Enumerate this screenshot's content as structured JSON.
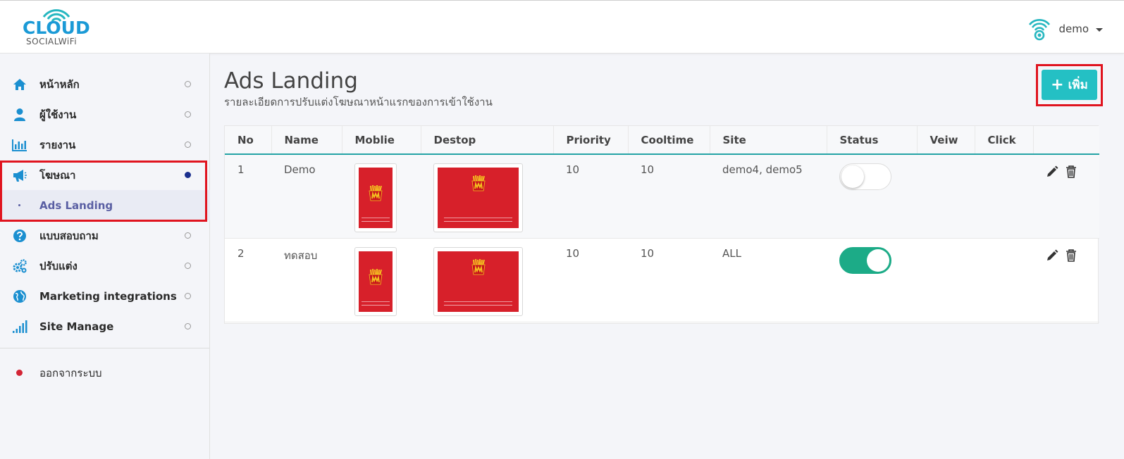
{
  "header": {
    "logo_main": "CLOUD",
    "logo_sub": "SOCIALWiFi",
    "username": "demo"
  },
  "sidebar": {
    "items": [
      {
        "label": "หน้าหลัก",
        "icon": "home-icon",
        "active": false
      },
      {
        "label": "ผู้ใช้งาน",
        "icon": "user-icon",
        "active": false
      },
      {
        "label": "รายงาน",
        "icon": "bar-chart-icon",
        "active": false
      },
      {
        "label": "โฆษณา",
        "icon": "megaphone-icon",
        "active": true
      },
      {
        "label": "Ads Landing",
        "icon": "",
        "active": false,
        "sub": true
      },
      {
        "label": "แบบสอบถาม",
        "icon": "question-icon",
        "active": false
      },
      {
        "label": "ปรับแต่ง",
        "icon": "cogs-icon",
        "active": false
      },
      {
        "label": "Marketing integrations",
        "icon": "globe-icon",
        "active": false
      },
      {
        "label": "Site Manage",
        "icon": "signal-icon",
        "active": false
      }
    ],
    "logout_label": "ออกจากระบบ"
  },
  "main": {
    "title": "Ads Landing",
    "subtitle": "รายละเอียดการปรับแต่งโฆษณาหน้าแรกของการเข้าใช้งาน",
    "add_button": "เพิ่ม",
    "columns": [
      "No",
      "Name",
      "Moblie",
      "Destop",
      "Priority",
      "Cooltime",
      "Site",
      "Status",
      "Veiw",
      "Click",
      ""
    ],
    "rows": [
      {
        "no": "1",
        "name": "Demo",
        "priority": "10",
        "cooltime": "10",
        "site": "demo4, demo5",
        "status_on": false,
        "view": "",
        "click": ""
      },
      {
        "no": "2",
        "name": "ทดสอบ",
        "priority": "10",
        "cooltime": "10",
        "site": "ALL",
        "status_on": true,
        "view": "",
        "click": ""
      }
    ]
  },
  "colors": {
    "accent": "#24c0c4",
    "toggle_on": "#1cab87",
    "highlight": "#e0141f",
    "brand_blue": "#1b9ad6",
    "ad_red": "#d7202a"
  }
}
